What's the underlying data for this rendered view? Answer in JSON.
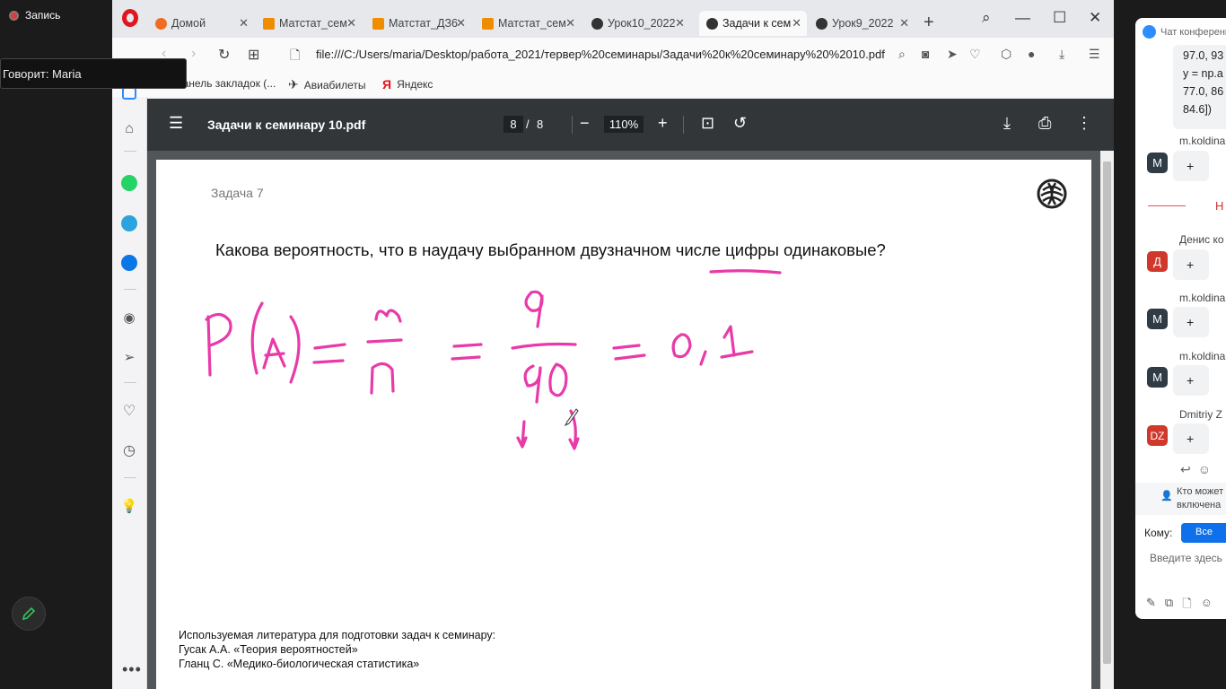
{
  "recording": {
    "label": "Запись"
  },
  "speaker": {
    "text": "Говорит: Maria"
  },
  "browser": {
    "tabs": [
      {
        "label": "Домой",
        "icon_color": "#ef6c22"
      },
      {
        "label": "Матстат_сем",
        "icon_color": "#f08c00"
      },
      {
        "label": "Матстат_ДЗ6",
        "icon_color": "#f08c00"
      },
      {
        "label": "Матстат_сем",
        "icon_color": "#f08c00"
      },
      {
        "label": "Урок10_2022",
        "icon_color": "#333333"
      },
      {
        "label": "Задачи к сем",
        "icon_color": "#333333"
      },
      {
        "label": "Урок9_2022",
        "icon_color": "#333333"
      }
    ],
    "url": "file:///C:/Users/maria/Desktop/работа_2021/тервер%20семинары/Задачи%20к%20семинару%20%2010.pdf",
    "bookmarks": [
      {
        "label": "Панель закладок (..."
      },
      {
        "label": "Авиабилеты"
      },
      {
        "label": "Яндекс"
      }
    ]
  },
  "pdf": {
    "title": "Задачи к семинару 10.pdf",
    "page_current": "8",
    "page_sep": "/",
    "page_total": "8",
    "zoom": "110%",
    "task_label": "Задача 7",
    "question": "Какова вероятность, что в наудачу выбранном двузначном числе цифры одинаковые?",
    "literature": [
      "Используемая литература для подготовки задач к семинару:",
      " Гусак А.А. «Теория вероятностей»",
      " Гланц С. «Медико-биологическая статистика»"
    ],
    "ink_color": "#e83aa8"
  },
  "chat": {
    "title": "Чат конференции",
    "code_lines": [
      "97.0, 93",
      "y = np.a",
      "77.0, 86",
      "84.6])"
    ],
    "messages": [
      {
        "name": "m.koldina",
        "avatar": "M",
        "avatar_color": "#2f3b45",
        "text": "+"
      },
      {
        "name": "Денис ко",
        "avatar": "Д",
        "avatar_color": "#d0382b",
        "text": "+"
      },
      {
        "name": "m.koldina",
        "avatar": "M",
        "avatar_color": "#2f3b45",
        "text": "+"
      },
      {
        "name": "m.koldina",
        "avatar": "M",
        "avatar_color": "#2f3b45",
        "text": "+"
      },
      {
        "name": "Dmitriy Z",
        "avatar": "DZ",
        "avatar_color": "#d0382b",
        "text": "+"
      }
    ],
    "new_marker": "Н",
    "notice_line1": "Кто может",
    "notice_line2": "включена",
    "to_label": "Кому:",
    "to_value": "Все",
    "input_placeholder": "Введите здесь"
  }
}
